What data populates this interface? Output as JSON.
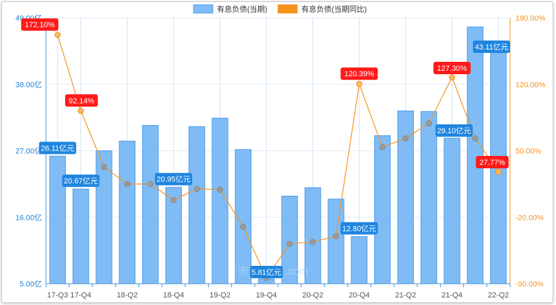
{
  "chart_data": {
    "type": "bar",
    "categories": [
      "17-Q3",
      "17-Q4",
      "18-Q1",
      "18-Q2",
      "18-Q3",
      "18-Q4",
      "19-Q1",
      "19-Q2",
      "19-Q3",
      "19-Q4",
      "20-Q1",
      "20-Q2",
      "20-Q3",
      "20-Q4",
      "21-Q1",
      "21-Q2",
      "21-Q3",
      "21-Q4",
      "22-Q1",
      "22-Q2"
    ],
    "x_tick_labels": [
      "17-Q3",
      "17-Q4",
      "18-Q2",
      "18-Q4",
      "19-Q2",
      "19-Q4",
      "20-Q2",
      "20-Q4",
      "21-Q2",
      "21-Q4",
      "22-Q2"
    ],
    "x_tick_categories": [
      "17-Q3",
      "17-Q4",
      "18-Q2",
      "18-Q4",
      "19-Q2",
      "19-Q4",
      "20-Q2",
      "20-Q4",
      "21-Q2",
      "21-Q4",
      "22-Q2"
    ],
    "series": [
      {
        "name": "有息负债(当期)",
        "type": "bar",
        "axis": "left",
        "color": "#7fbcf5",
        "values": [
          26.11,
          20.67,
          27.0,
          28.6,
          31.2,
          20.95,
          31.0,
          32.4,
          27.2,
          5.81,
          19.5,
          20.9,
          19.0,
          12.8,
          29.5,
          33.6,
          33.5,
          29.1,
          47.5,
          43.11
        ]
      },
      {
        "name": "有息负债(当期同比)",
        "type": "line",
        "axis": "right",
        "color": "#f7921e",
        "values": [
          172.1,
          92.14,
          33.0,
          15.0,
          15.0,
          -2.0,
          10.0,
          9.0,
          -30.0,
          -84.0,
          -48.0,
          -46.0,
          -40.0,
          120.39,
          54.0,
          63.0,
          79.0,
          127.3,
          63.0,
          27.77
        ]
      }
    ],
    "annotations": [
      {
        "series": 0,
        "index": 0,
        "label": "26.11亿元"
      },
      {
        "series": 0,
        "index": 1,
        "label": "20.67亿元"
      },
      {
        "series": 0,
        "index": 5,
        "label": "20.95亿元"
      },
      {
        "series": 0,
        "index": 9,
        "label": "5.81亿元"
      },
      {
        "series": 0,
        "index": 13,
        "label": "12.80亿元"
      },
      {
        "series": 0,
        "index": 17,
        "label": "29.10亿元"
      },
      {
        "series": 0,
        "index": 19,
        "label": "43.11亿元"
      },
      {
        "series": 1,
        "index": 0,
        "label": "172.10%"
      },
      {
        "series": 1,
        "index": 1,
        "label": "92.14%"
      },
      {
        "series": 1,
        "index": 13,
        "label": "120.39%"
      },
      {
        "series": 1,
        "index": 17,
        "label": "127.30%"
      },
      {
        "series": 1,
        "index": 19,
        "label": "27.77%"
      }
    ],
    "y_left": {
      "ylim": [
        5.0,
        49.0
      ],
      "ticks": [
        "5.00亿",
        "16.00亿",
        "27.00亿",
        "38.00亿",
        "49.00亿"
      ],
      "tick_values": [
        5,
        16,
        27,
        38,
        49
      ],
      "color": "#1e7ed6"
    },
    "y_right": {
      "ylim": [
        -90.0,
        190.0
      ],
      "ticks": [
        "-90.00%",
        "-20.00%",
        "50.00%",
        "120.00%",
        "190.00%"
      ],
      "tick_values": [
        -90,
        -20,
        50,
        120,
        190
      ],
      "color": "#f7921e"
    },
    "legend": {
      "placement": "top-center"
    },
    "grid": true,
    "watermark": "市值风云 .com"
  }
}
